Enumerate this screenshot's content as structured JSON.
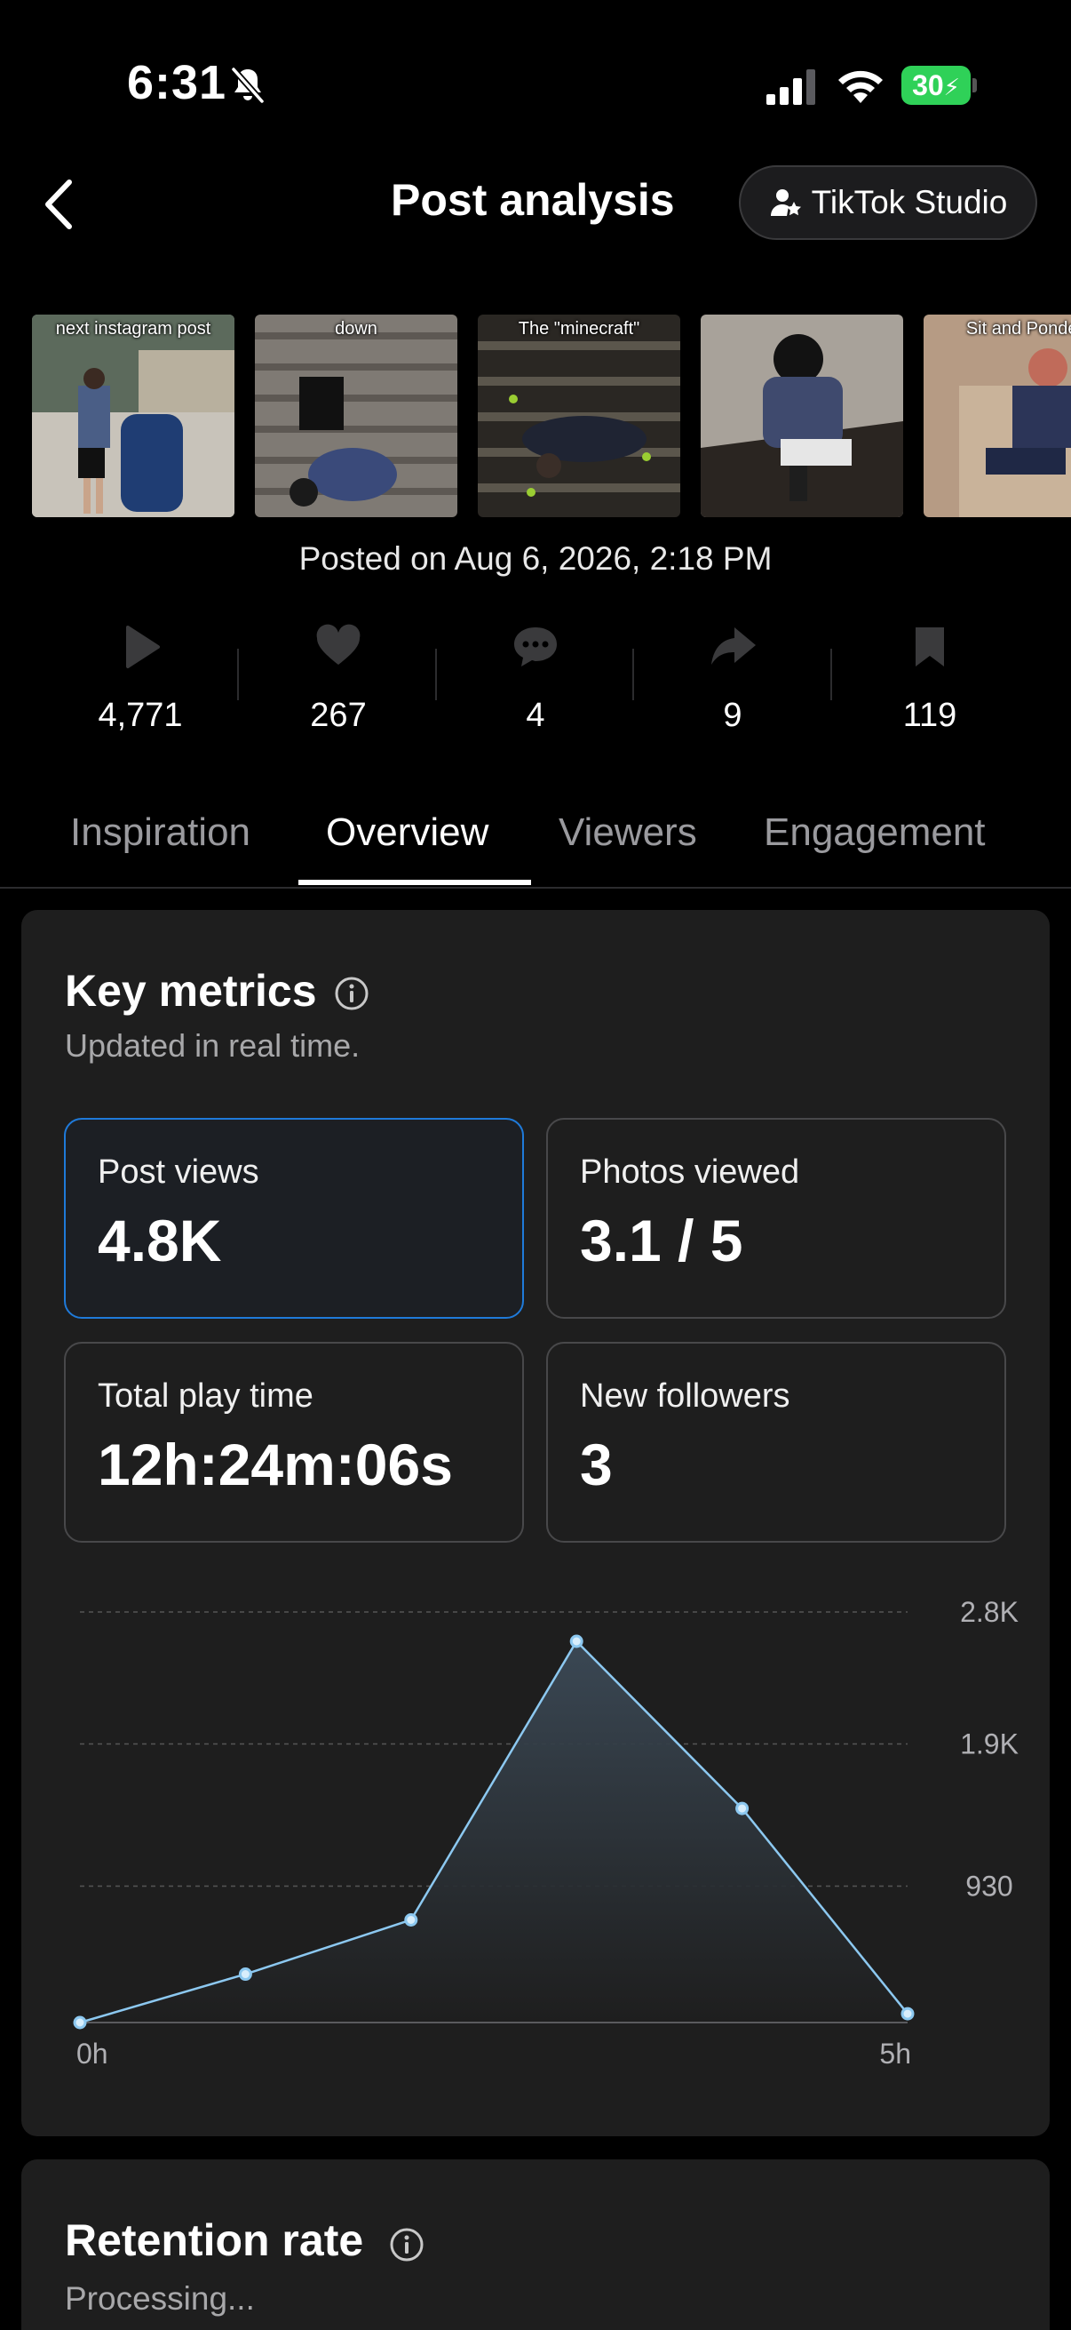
{
  "status_bar": {
    "time": "6:31",
    "battery": "30",
    "icons": [
      "bell-slash-icon",
      "cellular-signal-icon",
      "wifi-icon",
      "battery-charging-icon"
    ]
  },
  "header": {
    "title": "Post analysis",
    "studio_button": "TikTok Studio",
    "icons": [
      "chevron-left-icon",
      "person-star-icon"
    ]
  },
  "thumbnails": [
    {
      "caption": "next instagram post",
      "colors": [
        "#7e8c94",
        "#b9b3a8",
        "#1f3d73"
      ]
    },
    {
      "caption": "down",
      "colors": [
        "#8f8a85",
        "#5b5650",
        "#2c3d66"
      ]
    },
    {
      "caption": "The \"minecraft\"",
      "colors": [
        "#3e3c38",
        "#26221e",
        "#6d6a60"
      ]
    },
    {
      "caption": "",
      "colors": [
        "#a39d94",
        "#3f4a6e",
        "#2a2522"
      ]
    },
    {
      "caption": "Sit and Ponder",
      "colors": [
        "#b69b84",
        "#c9b39a",
        "#2c3558"
      ]
    }
  ],
  "posted_on": "Posted on Aug 6, 2026, 2:18 PM",
  "stats": [
    {
      "icon": "play-icon",
      "value": "4,771"
    },
    {
      "icon": "heart-icon",
      "value": "267"
    },
    {
      "icon": "comment-icon",
      "value": "4"
    },
    {
      "icon": "share-icon",
      "value": "9"
    },
    {
      "icon": "bookmark-icon",
      "value": "119"
    }
  ],
  "tabs": [
    "Inspiration",
    "Overview",
    "Viewers",
    "Engagement"
  ],
  "active_tab": "Overview",
  "key_metrics": {
    "title": "Key metrics",
    "subtitle": "Updated in real time.",
    "cards": [
      {
        "label": "Post views",
        "value": "4.8K",
        "selected": true
      },
      {
        "label": "Photos viewed",
        "value": "3.1 / 5",
        "selected": false
      },
      {
        "label": "Total play time",
        "value": "12h:24m:06s",
        "selected": false
      },
      {
        "label": "New followers",
        "value": "3",
        "selected": false
      }
    ]
  },
  "chart_data": {
    "type": "area",
    "x": [
      0,
      1,
      2,
      3,
      4,
      5
    ],
    "x_tick_labels": [
      "0h",
      "5h"
    ],
    "values": [
      0,
      330,
      700,
      2600,
      1460,
      60
    ],
    "y_ticks": [
      930,
      1900,
      2800
    ],
    "y_tick_labels": [
      "930",
      "1.9K",
      "2.8K"
    ],
    "ylim": [
      0,
      2800
    ],
    "grid": true,
    "line_color": "#8cc8f0"
  },
  "retention": {
    "title": "Retention rate",
    "status": "Processing..."
  },
  "colors": {
    "accent": "#1f7ad9",
    "background": "#000000",
    "card": "#1e1e1e",
    "battery": "#2fd158"
  }
}
